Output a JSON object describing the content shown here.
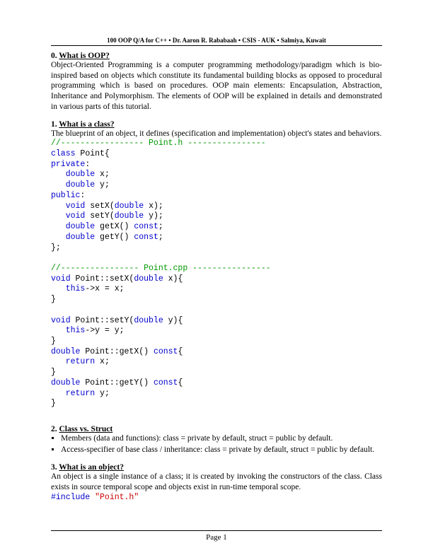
{
  "header": "100 OOP Q/A for C++ • Dr. Aaron R. Rababaah  •  CSIS - AUK  •  Salmiya, Kuwait",
  "s0": {
    "num": "0.",
    "title": "What is OOP?"
  },
  "p0": "Object-Oriented Programming is a computer programming methodology/paradigm which is bio-inspired based on objects which constitute its fundamental building blocks as opposed to procedural programming which is based on procedures. OOP main elements: Encapsulation, Abstraction, Inheritance and Polymorphism. The elements of OOP will be explained in details and demonstrated in various parts of this tutorial.",
  "s1": {
    "num": "1.",
    "title": "What is a class?"
  },
  "p1": "The blueprint of an object, it defines (specification and implementation) object's states and behaviors.",
  "code1": {
    "c0": "//----------------- Point.h ----------------",
    "c1a": "class",
    "c1b": " Point{",
    "c2a": "private",
    "c2b": ":",
    "c3a": "   ",
    "c3b": "double",
    "c3c": " x;",
    "c4a": "   ",
    "c4b": "double",
    "c4c": " y;",
    "c5a": "public",
    "c5b": ":",
    "c6a": "   ",
    "c6b": "void",
    "c6c": " setX(",
    "c6d": "double",
    "c6e": " x);",
    "c7a": "   ",
    "c7b": "void",
    "c7c": " setY(",
    "c7d": "double",
    "c7e": " y);",
    "c8a": "   ",
    "c8b": "double",
    "c8c": " getX() ",
    "c8d": "const",
    "c8e": ";",
    "c9a": "   ",
    "c9b": "double",
    "c9c": " getY() ",
    "c9d": "const",
    "c9e": ";",
    "c10": "};",
    "c11": "",
    "c12": "//---------------- Point.cpp ----------------",
    "c13a": "void",
    "c13b": " Point::setX(",
    "c13c": "double",
    "c13d": " x){",
    "c14a": "   ",
    "c14b": "this",
    "c14c": "->x = x;",
    "c15": "}",
    "c16": "",
    "c17a": "void",
    "c17b": " Point::setY(",
    "c17c": "double",
    "c17d": " y){",
    "c18a": "   ",
    "c18b": "this",
    "c18c": "->y = y;",
    "c19": "}",
    "c20a": "double",
    "c20b": " Point::getX() ",
    "c20c": "const",
    "c20d": "{",
    "c21a": "   ",
    "c21b": "return",
    "c21c": " x;",
    "c22": "}",
    "c23a": "double",
    "c23b": " Point::getY() ",
    "c23c": "const",
    "c23d": "{",
    "c24a": "   ",
    "c24b": "return",
    "c24c": " y;",
    "c25": "}"
  },
  "s2": {
    "num": "2.",
    "title": "Class vs. Struct"
  },
  "b2a": "Members (data and functions): class = private by default, struct =  public by default.",
  "b2b": "Access-specifier of base class / inheritance: class = private by default, struct = public by default.",
  "s3": {
    "num": "3.",
    "title": "What is an object?"
  },
  "p3": "An object is a single instance of a class; it is created by invoking the constructors of the class. Class exists in source temporal scope and objects exist in run-time temporal scope.",
  "code3": {
    "a": "#include",
    "b": " ",
    "c": "\"Point.h\""
  },
  "footer": "Page 1"
}
